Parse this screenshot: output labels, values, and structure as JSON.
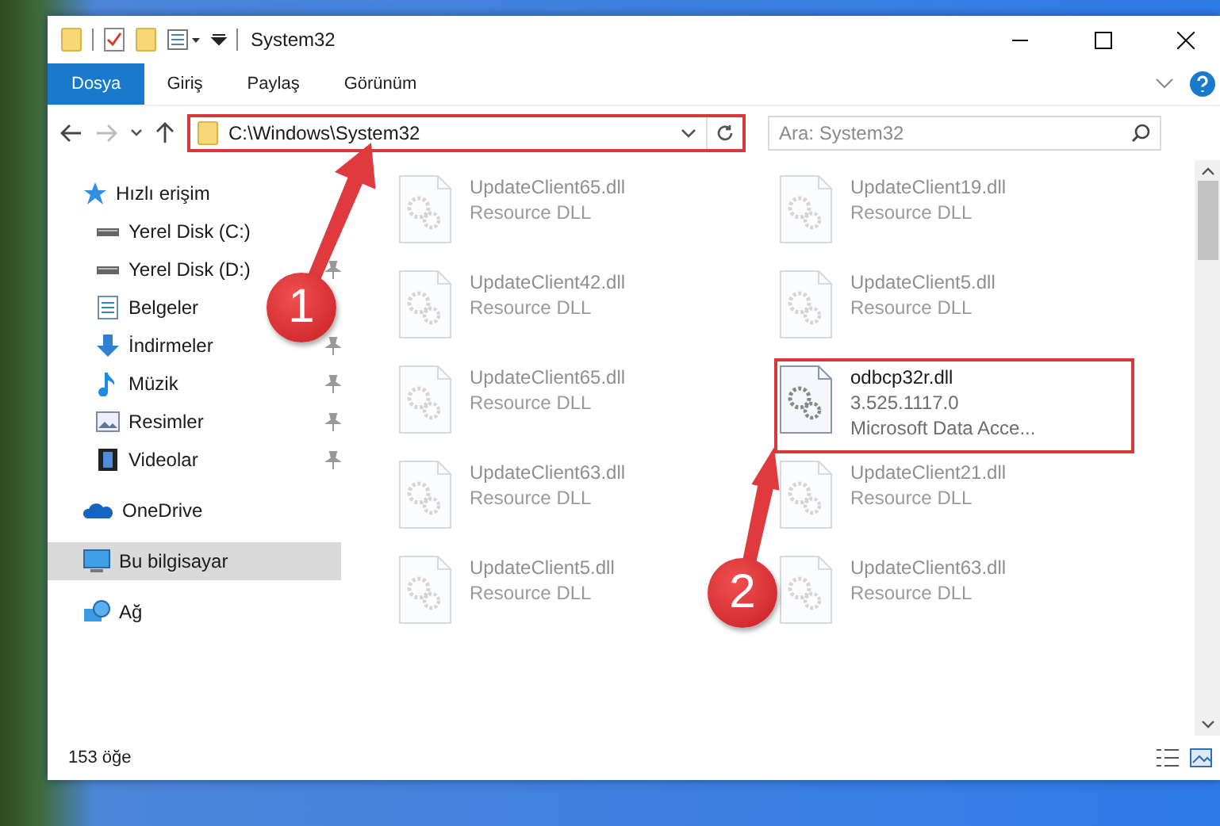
{
  "window": {
    "title": "System32"
  },
  "ribbon_tabs": [
    {
      "label": "Dosya",
      "selected": true
    },
    {
      "label": "Giriş",
      "selected": false
    },
    {
      "label": "Paylaş",
      "selected": false
    },
    {
      "label": "Görünüm",
      "selected": false
    }
  ],
  "address_bar": {
    "path": "C:\\Windows\\System32",
    "annotated": true
  },
  "search": {
    "placeholder": "Ara: System32"
  },
  "sidebar": {
    "items": [
      {
        "label": "Hızlı erişim",
        "kind": "star",
        "selected": false,
        "children": [
          {
            "label": "Yerel Disk (C:)",
            "kind": "drive",
            "pinned": false,
            "selected": false
          },
          {
            "label": "Yerel Disk (D:)",
            "kind": "drive",
            "pinned": true,
            "selected": false
          },
          {
            "label": "Belgeler",
            "kind": "document",
            "pinned": false,
            "selected": false
          },
          {
            "label": "İndirmeler",
            "kind": "download",
            "pinned": true,
            "selected": false
          },
          {
            "label": "Müzik",
            "kind": "music",
            "pinned": true,
            "selected": false
          },
          {
            "label": "Resimler",
            "kind": "picture",
            "pinned": true,
            "selected": false
          },
          {
            "label": "Videolar",
            "kind": "video",
            "pinned": true,
            "selected": false
          }
        ]
      },
      {
        "label": "OneDrive",
        "kind": "cloud",
        "selected": false
      },
      {
        "label": "Bu bilgisayar",
        "kind": "computer",
        "selected": true
      },
      {
        "label": "Ağ",
        "kind": "network",
        "selected": false
      }
    ]
  },
  "files": [
    {
      "name": "UpdateClient65.dll",
      "details": [
        "Resource DLL"
      ],
      "faded": true,
      "annotated": false
    },
    {
      "name": "UpdateClient19.dll",
      "details": [
        "Resource DLL"
      ],
      "faded": true,
      "annotated": false
    },
    {
      "name": "UpdateClient42.dll",
      "details": [
        "Resource DLL"
      ],
      "faded": true,
      "annotated": false
    },
    {
      "name": "UpdateClient5.dll",
      "details": [
        "Resource DLL"
      ],
      "faded": true,
      "annotated": false
    },
    {
      "name": "UpdateClient65.dll",
      "details": [
        "Resource DLL"
      ],
      "faded": true,
      "annotated": false
    },
    {
      "name": "odbcp32r.dll",
      "details": [
        "3.525.1117.0",
        "Microsoft Data Acce..."
      ],
      "faded": false,
      "annotated": true
    },
    {
      "name": "UpdateClient63.dll",
      "details": [
        "Resource DLL"
      ],
      "faded": true,
      "annotated": false
    },
    {
      "name": "UpdateClient21.dll",
      "details": [
        "Resource DLL"
      ],
      "faded": true,
      "annotated": false
    },
    {
      "name": "UpdateClient5.dll",
      "details": [
        "Resource DLL"
      ],
      "faded": true,
      "annotated": false
    },
    {
      "name": "UpdateClient63.dll",
      "details": [
        "Resource DLL"
      ],
      "faded": true,
      "annotated": false
    }
  ],
  "status_bar": {
    "count": "153 öğe"
  },
  "callouts": [
    {
      "label": "1"
    },
    {
      "label": "2"
    }
  ]
}
